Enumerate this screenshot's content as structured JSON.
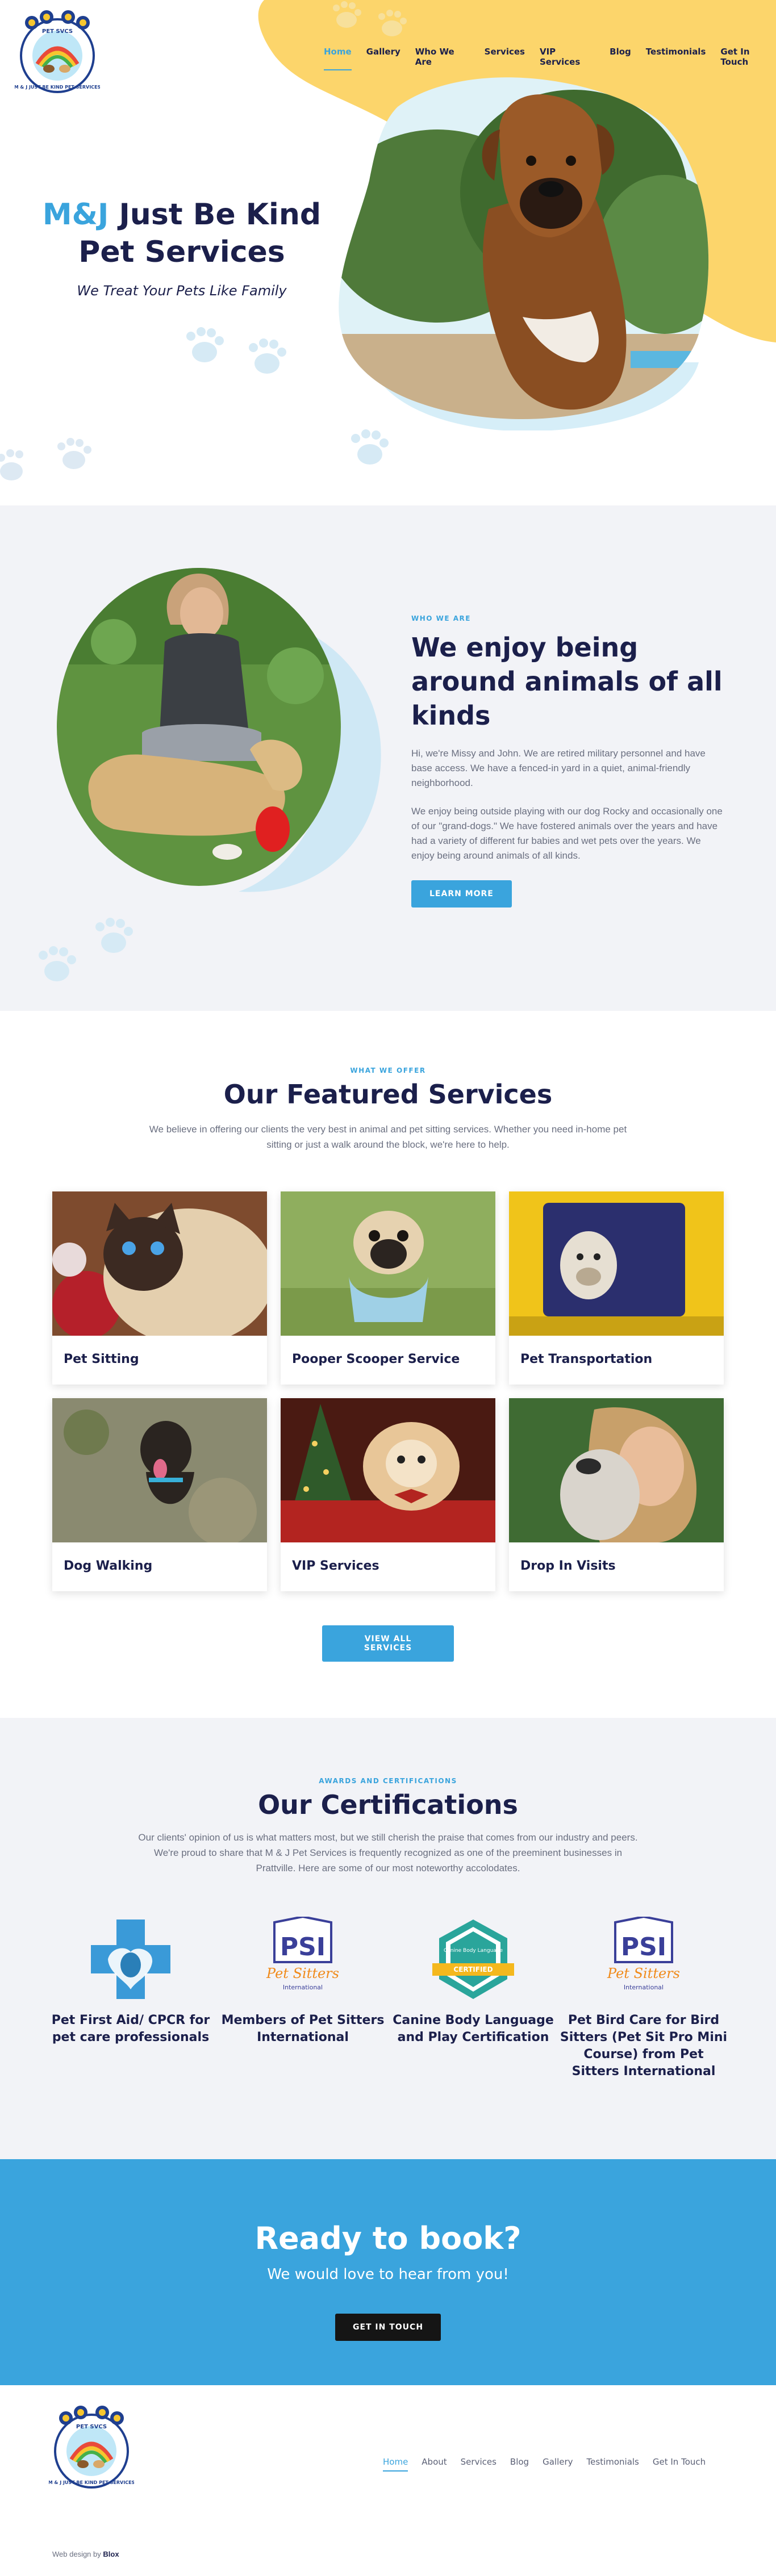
{
  "nav": {
    "items": [
      {
        "label": "Home",
        "active": true
      },
      {
        "label": "Gallery"
      },
      {
        "label": "Who We Are"
      },
      {
        "label": "Services"
      },
      {
        "label": "VIP Services"
      },
      {
        "label": "Blog"
      },
      {
        "label": "Testimonials"
      },
      {
        "label": "Get In Touch"
      }
    ]
  },
  "logo": {
    "alt": "M&J Just Be Kind Pet Services",
    "top_text": "PET SVCS",
    "ring_text": "M & J JUST BE KIND PET SERVICES"
  },
  "hero": {
    "title_accent": "M&J",
    "title_rest": " Just Be Kind Pet Services",
    "subtitle": "We Treat Your Pets Like Family"
  },
  "about": {
    "eyebrow": "WHO WE ARE",
    "heading": "We enjoy being around animals of all kinds",
    "para1": "Hi, we're Missy and John. We are retired military personnel and have base access. We have a fenced-in yard in a quiet, animal-friendly neighborhood.",
    "para2": "We enjoy being outside playing with our dog Rocky and occasionally one of our \"grand-dogs.\" We have fostered animals over the years and have had a variety of different fur babies and wet pets over the years. We enjoy being around animals of all kinds.",
    "button": "LEARN MORE"
  },
  "services": {
    "eyebrow": "WHAT WE OFFER",
    "heading": "Our Featured Services",
    "intro": "We believe in offering our clients the very best in animal and pet sitting services. Whether you need in-home pet sitting or just a walk around the block, we're here to help.",
    "cards": [
      {
        "label": "Pet Sitting"
      },
      {
        "label": "Pooper Scooper Service"
      },
      {
        "label": "Pet Transportation"
      },
      {
        "label": "Dog Walking"
      },
      {
        "label": "VIP Services"
      },
      {
        "label": "Drop In Visits"
      }
    ],
    "button": "VIEW ALL SERVICES"
  },
  "certs": {
    "eyebrow": "AWARDS AND CERTIFICATIONS",
    "heading": "Our Certifications",
    "intro": "Our clients' opinion of us is what matters most, but we still cherish the praise that comes from our industry and peers. We're proud to share that M & J Pet Services is frequently recognized as one of the preeminent businesses in Prattville. Here are some of our most noteworthy accolodates.",
    "items": [
      {
        "title": "Pet First Aid/ CPCR for pet care professionals"
      },
      {
        "title": "Members of Pet Sitters International",
        "badge_main": "PSI",
        "badge_script": "Pet Sitters",
        "badge_small": "International"
      },
      {
        "title": "Canine Body Language and Play Certification",
        "badge_main": "Canine Body Language",
        "badge_ribbon": "CERTIFIED"
      },
      {
        "title": "Pet Bird Care for Bird Sitters (Pet Sit Pro Mini Course) from Pet Sitters International",
        "badge_main": "PSI",
        "badge_script": "Pet Sitters",
        "badge_small": "International"
      }
    ]
  },
  "cta": {
    "heading": "Ready to book?",
    "sub": "We would love to hear from you!",
    "button": "GET IN TOUCH"
  },
  "footer": {
    "items": [
      {
        "label": "Home",
        "active": true
      },
      {
        "label": "About"
      },
      {
        "label": "Services"
      },
      {
        "label": "Blog"
      },
      {
        "label": "Gallery"
      },
      {
        "label": "Testimonials"
      },
      {
        "label": "Get In Touch"
      }
    ],
    "credit_prefix": "Web design by",
    "credit_brand": "Blox"
  },
  "colors": {
    "accent": "#3aa4dd",
    "navy": "#1b1f4b",
    "yellow": "#fcd56b",
    "light_bg": "#f2f3f7"
  }
}
